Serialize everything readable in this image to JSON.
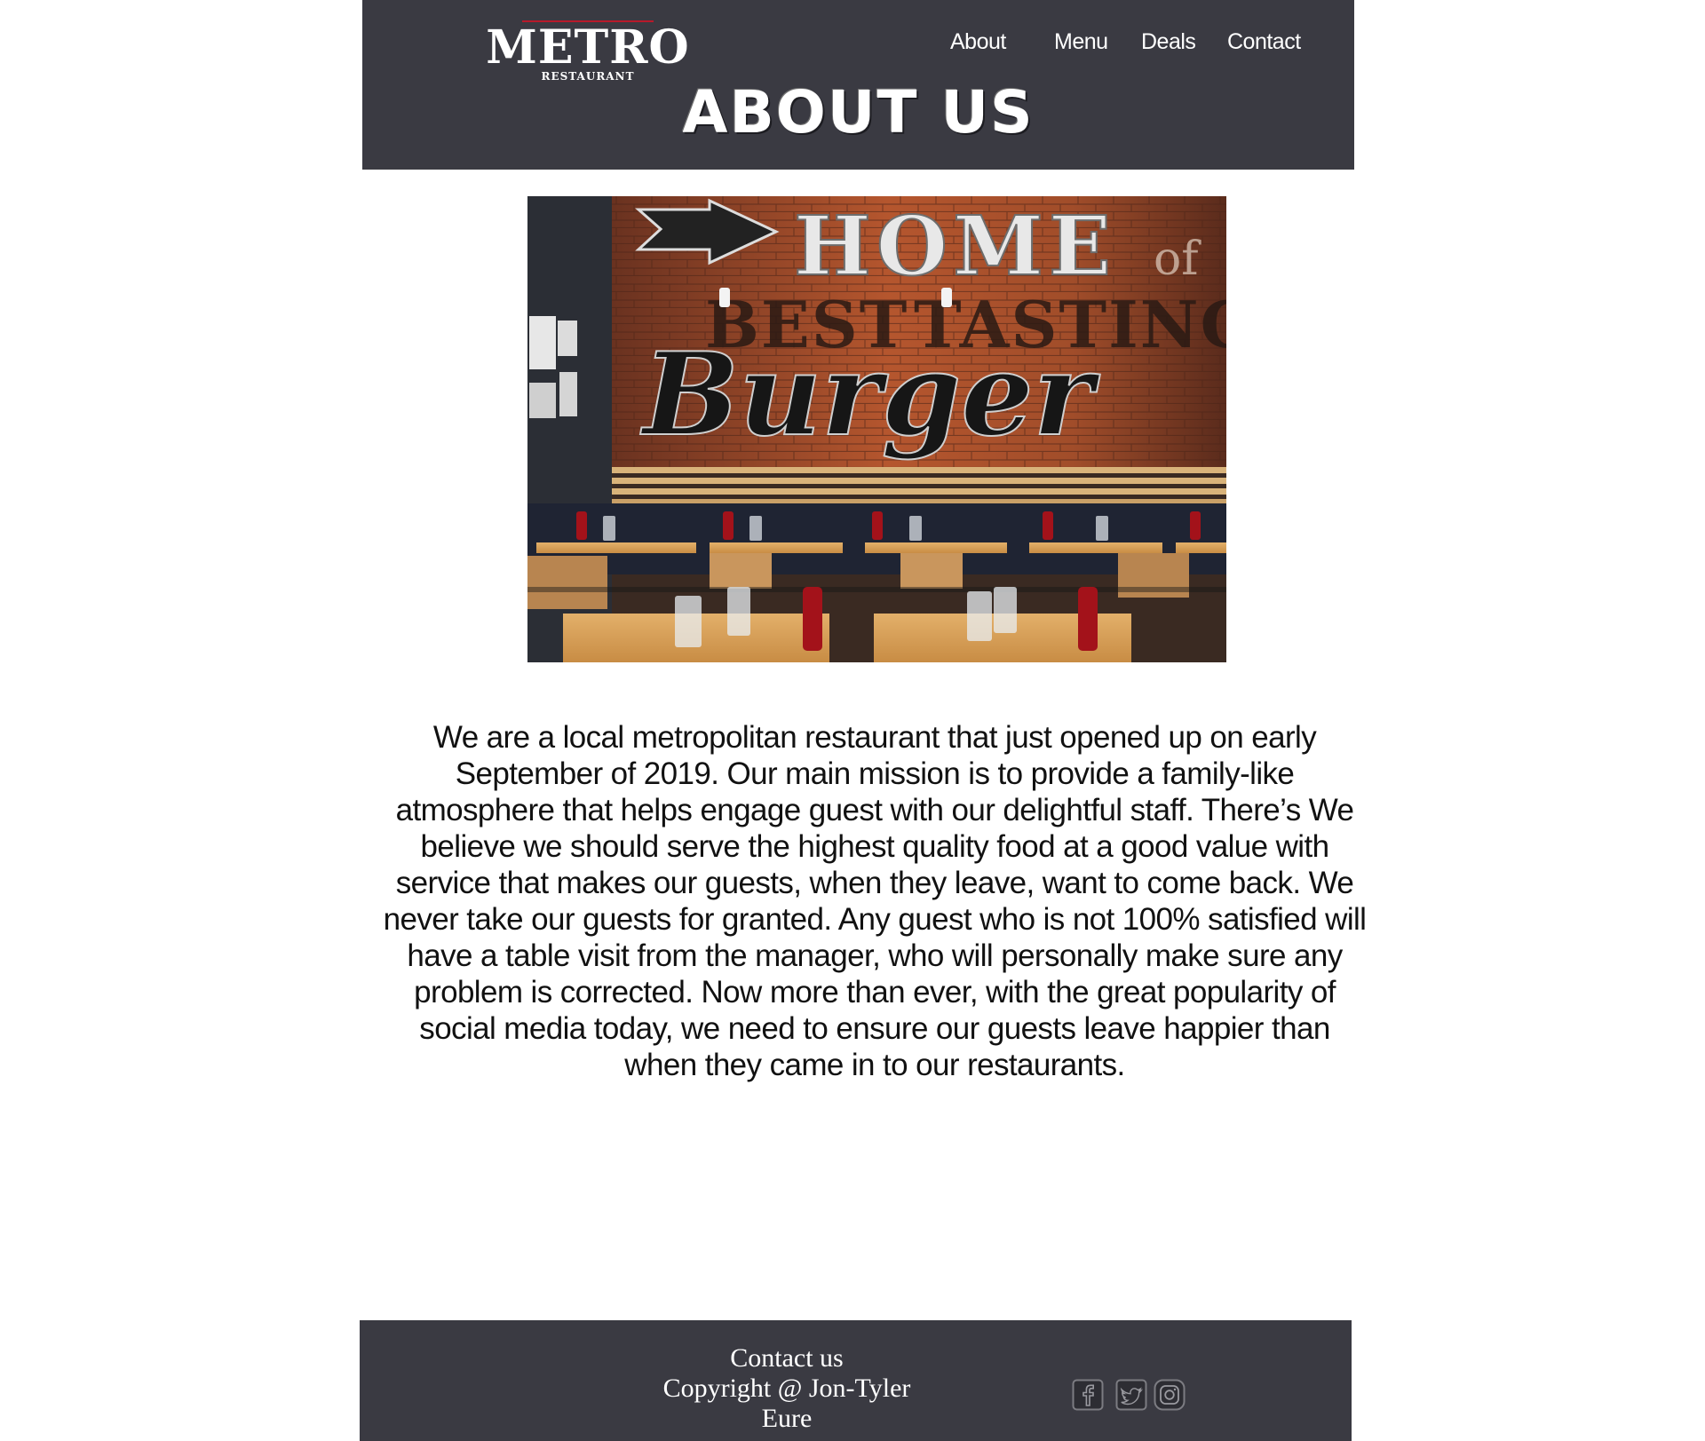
{
  "header": {
    "logo": {
      "name": "METRO",
      "tagline": "RESTAURANT",
      "accent_color": "#b8192a"
    },
    "nav": [
      {
        "label": "About"
      },
      {
        "label": "Menu"
      },
      {
        "label": "Deals"
      },
      {
        "label": "Contact"
      }
    ],
    "page_title": "ABOUT US",
    "background_color": "#3a3a42"
  },
  "hero_image": {
    "mural_words": [
      "HOME",
      "of",
      "BEST",
      "TASTING",
      "Burger"
    ]
  },
  "main": {
    "mission_text": "We are a local metropolitan restaurant that just opened up on early September of 2019.  Our main mission is to provide a family-like atmosphere that helps engage guest with our delightful staff. There’s We believe we should serve the highest quality food at a good value with service that makes our guests, when they leave, want to come back. We never take our guests for granted. Any guest who is not 100% satisfied will have a table visit from the manager, who will personally make sure any problem is corrected. Now more than ever, with the great popularity of social media today, we need to ensure our guests leave happier than when they came in to our restaurants."
  },
  "footer": {
    "contact_label": "Contact us",
    "copyright": "Copyright @ Jon-Tyler Eure",
    "social_icons": [
      "facebook-icon",
      "twitter-icon",
      "instagram-icon"
    ]
  }
}
